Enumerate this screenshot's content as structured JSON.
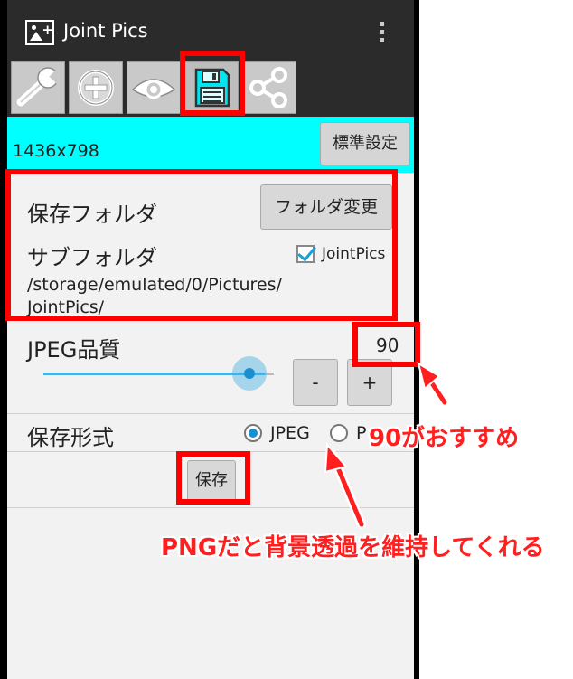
{
  "app": {
    "title": "Joint Pics",
    "icon": "image-plus-icon"
  },
  "toolbar": {
    "tools": [
      {
        "id": "settings",
        "icon": "wrench-icon"
      },
      {
        "id": "add",
        "icon": "add-circle-icon"
      },
      {
        "id": "preview",
        "icon": "eye-icon"
      },
      {
        "id": "save",
        "icon": "floppy-disk-icon",
        "selected": true
      },
      {
        "id": "share",
        "icon": "share-icon"
      }
    ]
  },
  "size": {
    "label": "1436x798",
    "standard_button": "標準設定"
  },
  "save_folder": {
    "label": "保存フォルダ",
    "change_button": "フォルダ変更"
  },
  "subfolder": {
    "label": "サブフォルダ",
    "checkbox_label": "JointPics",
    "checked": true,
    "path_line1": "/storage/emulated/0/Pictures/",
    "path_line2": "JointPics/"
  },
  "jpeg_quality": {
    "label": "JPEG品質",
    "value": "90",
    "slider_fraction": 0.9,
    "minus_label": "-",
    "plus_label": "+"
  },
  "format": {
    "label": "保存形式",
    "options": [
      {
        "label": "JPEG",
        "selected": true
      },
      {
        "label": "P",
        "selected": false
      }
    ]
  },
  "save_button": "保存",
  "annotations": {
    "quality_tip": "90がおすすめ",
    "png_tip": "PNGだと背景透過を維持してくれる"
  },
  "colors": {
    "accent_cyan": "#00ffff",
    "annotation_red": "#ff0000",
    "slider_blue": "#49b0e0",
    "appbar": "#2b2b2b"
  }
}
